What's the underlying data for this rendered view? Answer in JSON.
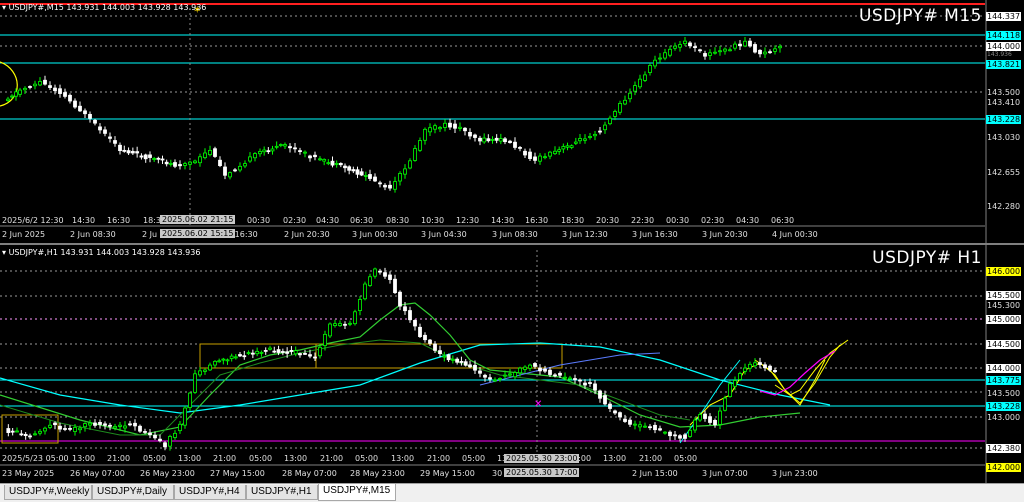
{
  "top_chart": {
    "symbol_info": "USDJPY#,M15  143.931 144.003 143.928 143.936",
    "title": "USDJPY# M15",
    "price_labels": {
      "l144337": "144.337",
      "l144118": "144.118",
      "l144000": "144.000",
      "l143936": "143.936",
      "l143821": "143.821",
      "l143500": "143.500",
      "l143410": "143.410",
      "l143228": "143.228",
      "l143030": "143.030",
      "l142655": "142.655",
      "l142280": "142.280"
    },
    "time_row1": [
      "2025/6/2 12:30",
      "14:30",
      "16:30",
      "18:3",
      "21:15",
      "00:30",
      "02:30",
      "04:30",
      "06:30",
      "08:30",
      "10:30",
      "12:30",
      "14:30",
      "16:30",
      "18:30",
      "20:30",
      "22:30",
      "00:30",
      "02:30",
      "04:30",
      "06:30"
    ],
    "cursor_time_1": "2025.06.02 21:15",
    "time_row2": [
      "2 Jun 2025",
      "2 Jun 08:30",
      "2 Jun 15:15",
      "2 Jun 20:30",
      "3 Jun 00:30",
      "3 Jun 04:30",
      "3 Jun 08:30",
      "3 Jun 12:30",
      "3 Jun 16:30",
      "3 Jun 20:30",
      "4 Jun 00:30"
    ],
    "cursor_time_2": "2025.06.02 15:15",
    "time_row2_prefix": "2 Ju"
  },
  "bottom_chart": {
    "symbol_info": "USDJPY#,H1  143.931 144.003 143.928 143.936",
    "title": "USDJPY# H1",
    "price_labels": {
      "l146000": "146.000",
      "l145500": "145.500",
      "l145300": "145.300",
      "l145000": "145.000",
      "l144500": "144.500",
      "l144000": "144.000",
      "l143775": "143.775",
      "l143500": "143.500",
      "l143228": "143.228",
      "l143000": "143.000",
      "l142380": "142.380",
      "l142000": "142.000"
    },
    "time_labels": [
      "23 May 2025",
      "26 May 07:00",
      "26 May 23:00",
      "27 May 15:00",
      "28 May 07:00",
      "28 May 23:00",
      "29 May 15:00",
      "30",
      "2025.05.30 17:00",
      "2 Jun 15:00",
      "3 Jun 07:00",
      "3 Jun 23:00"
    ],
    "time_row1": [
      "2025/5/23 05:00",
      "13:00",
      "21:00",
      "05:00",
      "13:00",
      "21:00",
      "05:00",
      "13:00",
      "21:00",
      "05:00",
      "13:00",
      "21:00",
      "05:00",
      "13:00",
      "21:00",
      "05:00",
      "13:00",
      "21:00",
      "05:00"
    ],
    "cursor_time_1": "2025.05.30 23:00"
  },
  "tabs": [
    "USDJPY#,Weekly",
    "USDJPY#,Daily",
    "USDJPY#,H4",
    "USDJPY#,H1",
    "USDJPY#,M15"
  ],
  "active_tab": "USDJPY#,M15",
  "colors": {
    "up": "#00ff00",
    "down": "#ffffff",
    "cyan": "#00ffff",
    "yellow": "#ffff00",
    "green_ma": "#32cd32",
    "blue_ma": "#1e90ff",
    "magenta": "#ff00ff"
  }
}
